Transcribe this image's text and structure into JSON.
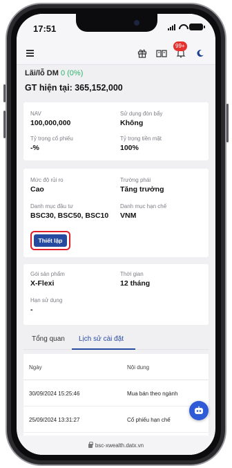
{
  "status_bar": {
    "time": "17:51"
  },
  "header": {
    "notification_badge": "99+"
  },
  "summary": {
    "pl_label": "Lãi/lỗ DM",
    "pl_value": "0 (0%)",
    "gt_label": "GT hiện tại:",
    "gt_value": "365,152,000"
  },
  "nav_card": {
    "nav_label": "NAV",
    "nav_value": "100,000,000",
    "leverage_label": "Sử dụng đòn bẩy",
    "leverage_value": "Không",
    "stock_ratio_label": "Tỷ trọng cổ phiếu",
    "stock_ratio_value": "-%",
    "cash_ratio_label": "Tỷ trọng tiền mặt",
    "cash_ratio_value": "100%"
  },
  "risk_card": {
    "risk_label": "Mức độ rủi ro",
    "risk_value": "Cao",
    "school_label": "Trường phái",
    "school_value": "Tăng trưởng",
    "portfolio_label": "Danh mục đầu tư",
    "portfolio_value": "BSC30, BSC50, BSC10",
    "restricted_label": "Danh mục hạn chế",
    "restricted_value": "VNM",
    "setup_button": "Thiết lập"
  },
  "product_card": {
    "package_label": "Gói sản phẩm",
    "package_value": "X-Flexi",
    "duration_label": "Thời gian",
    "duration_value": "12 tháng",
    "expiry_label": "Hạn sử dụng",
    "expiry_value": "-"
  },
  "tabs": [
    {
      "label": "Tổng quan",
      "active": false
    },
    {
      "label": "Lịch sử cài đặt",
      "active": true
    }
  ],
  "history": {
    "columns": [
      "Ngày",
      "Nội dung"
    ],
    "rows": [
      {
        "date": "30/09/2024 15:25:46",
        "content": "Mua bán theo ngành"
      },
      {
        "date": "25/09/2024 13:31:27",
        "content": "Cổ phiếu hạn chế"
      }
    ]
  },
  "browser": {
    "url": "bsc-xwealth.datx.vn"
  },
  "colors": {
    "accent": "#274aa1",
    "profit": "#2fb36b",
    "highlight": "#e01c26",
    "badge": "#e5322f"
  }
}
